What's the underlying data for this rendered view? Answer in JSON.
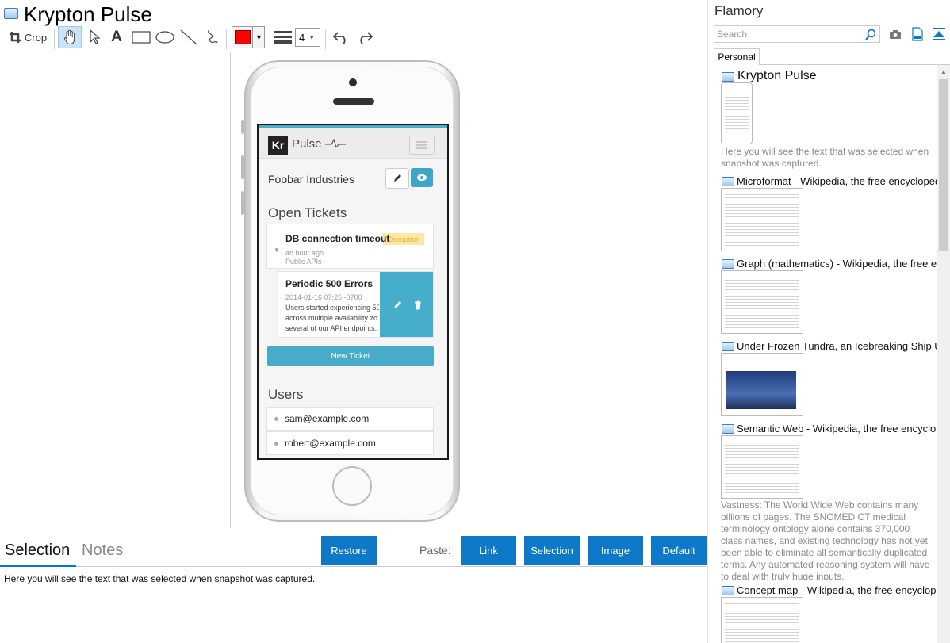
{
  "window": {
    "title": "Krypton Pulse"
  },
  "toolbar": {
    "crop_label": "Crop",
    "tools": [
      "hand-icon",
      "pointer-icon",
      "text-icon",
      "rectangle-icon",
      "ellipse-icon",
      "line-icon",
      "freehand-icon"
    ],
    "stroke_color": "#ff0000",
    "line_width": "4"
  },
  "phone": {
    "brand_logo": "Kr",
    "brand_name": "Pulse",
    "company": "Foobar Industries",
    "open_tickets_heading": "Open Tickets",
    "ticket1": {
      "title": "DB connection timeout",
      "badge": "Disruption",
      "time": "an hour ago",
      "category": "Public APIs"
    },
    "ticket2": {
      "title": "Periodic 500 Errors",
      "date": "2014-01-16 07:25 -0700",
      "description": "Users started experiencing 50\nacross multiple availability zo\nseveral of our API endpoints."
    },
    "new_ticket": "New Ticket",
    "users_heading": "Users",
    "users": [
      "sam@example.com",
      "robert@example.com"
    ],
    "accent": "#45aecb"
  },
  "bottom": {
    "tabs": [
      "Selection",
      "Notes"
    ],
    "restore": "Restore",
    "paste_label": "Paste:",
    "paste_buttons": [
      "Link",
      "Selection",
      "Image",
      "Default"
    ],
    "selection_text": "Here you will see the text that was selected when snapshot was captured.",
    "accent": "#0e79c9"
  },
  "sidebar": {
    "app_name": "Flamory",
    "search_placeholder": "Search",
    "tab": "Personal",
    "items": [
      {
        "title": "Krypton Pulse",
        "text": "Here you will see the text that was selected when snapshot was captured."
      },
      {
        "title": "Microformat - Wikipedia, the free encyclopedia",
        "text": ""
      },
      {
        "title": "Graph (mathematics) - Wikipedia, the free ency",
        "text": ""
      },
      {
        "title": "Under Frozen Tundra, an Icebreaking Ship Unco",
        "text": ""
      },
      {
        "title": "Semantic Web - Wikipedia, the free encycloped",
        "text": "Vastness: The World Wide Web contains many billions of pages. The SNOMED CT medical terminology ontology alone contains 370,000 class names, and existing technology has not yet been able to eliminate all semantically duplicated terms. Any automated reasoning system will have to deal with truly huge inputs."
      },
      {
        "title": "Concept map - Wikipedia, the free encyclopedi",
        "text": ""
      }
    ]
  }
}
